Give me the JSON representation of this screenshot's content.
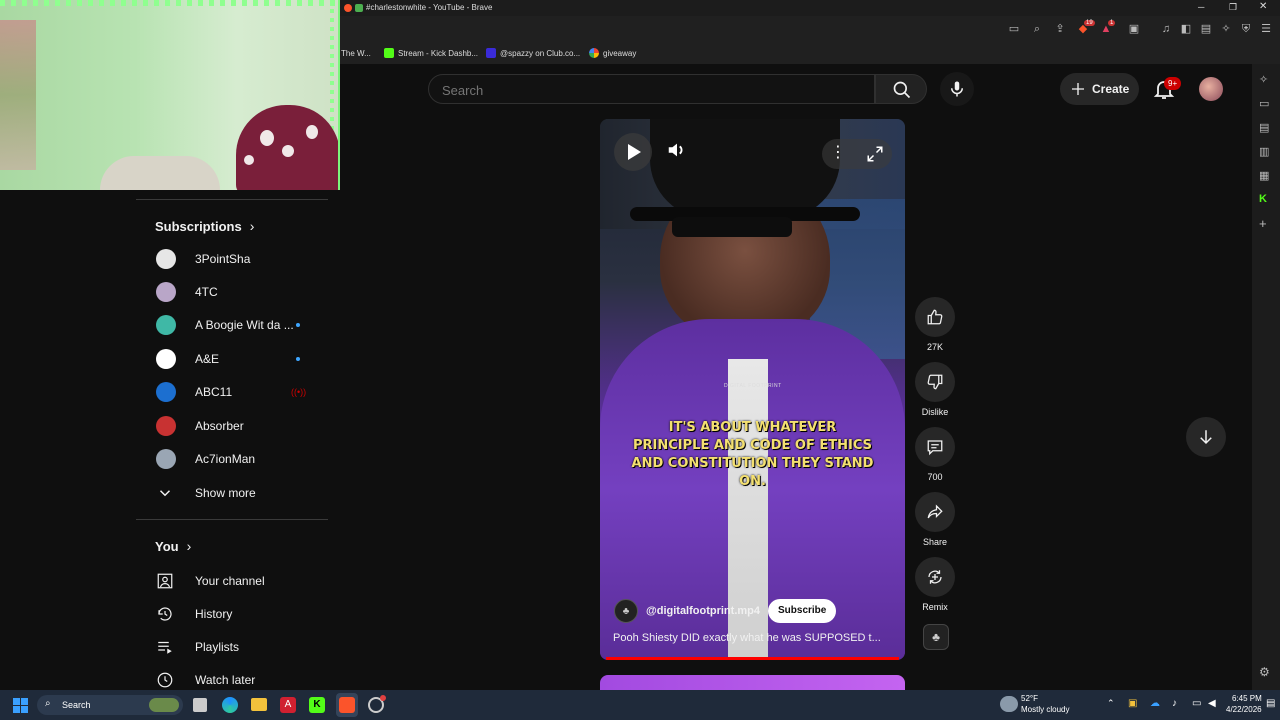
{
  "browser": {
    "window_title": "#charlestonwhite - YouTube - Brave",
    "bookmarks": [
      {
        "label": "The W...",
        "color": "#444444"
      },
      {
        "label": "Stream - Kick Dashb...",
        "color": "#53fc18"
      },
      {
        "label": "@spazzy on Club.co...",
        "color": "#3a2bd8"
      },
      {
        "label": "giveaway",
        "color": "#e8a030"
      }
    ],
    "extension_badges": [
      "19",
      "1"
    ]
  },
  "header": {
    "search_placeholder": "Search",
    "create_label": "Create",
    "notification_count": "9+"
  },
  "sidebar": {
    "subscriptions_title": "Subscriptions",
    "subscriptions": [
      {
        "name": "3PointSha",
        "color": "#e6e6e6",
        "indicator": "none"
      },
      {
        "name": "4TC",
        "color": "#b9a6c8",
        "indicator": "none"
      },
      {
        "name": "A Boogie Wit da ...",
        "color": "#3fb8a6",
        "indicator": "dot"
      },
      {
        "name": "A&E",
        "color": "#ffffff",
        "indicator": "dot"
      },
      {
        "name": "ABC11",
        "color": "#1c6fd0",
        "indicator": "live"
      },
      {
        "name": "Absorber",
        "color": "#c83232",
        "indicator": "none"
      },
      {
        "name": "Ac7ionMan",
        "color": "#9aa6b4",
        "indicator": "none"
      }
    ],
    "show_more_label": "Show more",
    "you_title": "You",
    "you_items": [
      {
        "label": "Your channel",
        "icon": "person-box-icon"
      },
      {
        "label": "History",
        "icon": "history-icon"
      },
      {
        "label": "Playlists",
        "icon": "playlists-icon"
      },
      {
        "label": "Watch later",
        "icon": "clock-icon"
      }
    ]
  },
  "video": {
    "caption": "IT'S ABOUT WHATEVER PRINCIPLE AND CODE OF ETHICS AND CONSTITUTION THEY STAND ON.",
    "watermark": "DIGITAL FOOTPRINT",
    "channel": "@digitalfootprint.mp4",
    "subscribe_label": "Subscribe",
    "title": "Pooh Shiesty DID exactly what he was SUPPOSED t...",
    "progress_fraction": 1.0
  },
  "actions": {
    "like_count": "27K",
    "dislike_label": "Dislike",
    "comment_count": "700",
    "share_label": "Share",
    "remix_label": "Remix"
  },
  "taskbar": {
    "search_label": "Search",
    "weather_temp": "52°F",
    "weather_desc": "Mostly cloudy",
    "time": "6:45 PM",
    "date": "4/22/2026"
  }
}
